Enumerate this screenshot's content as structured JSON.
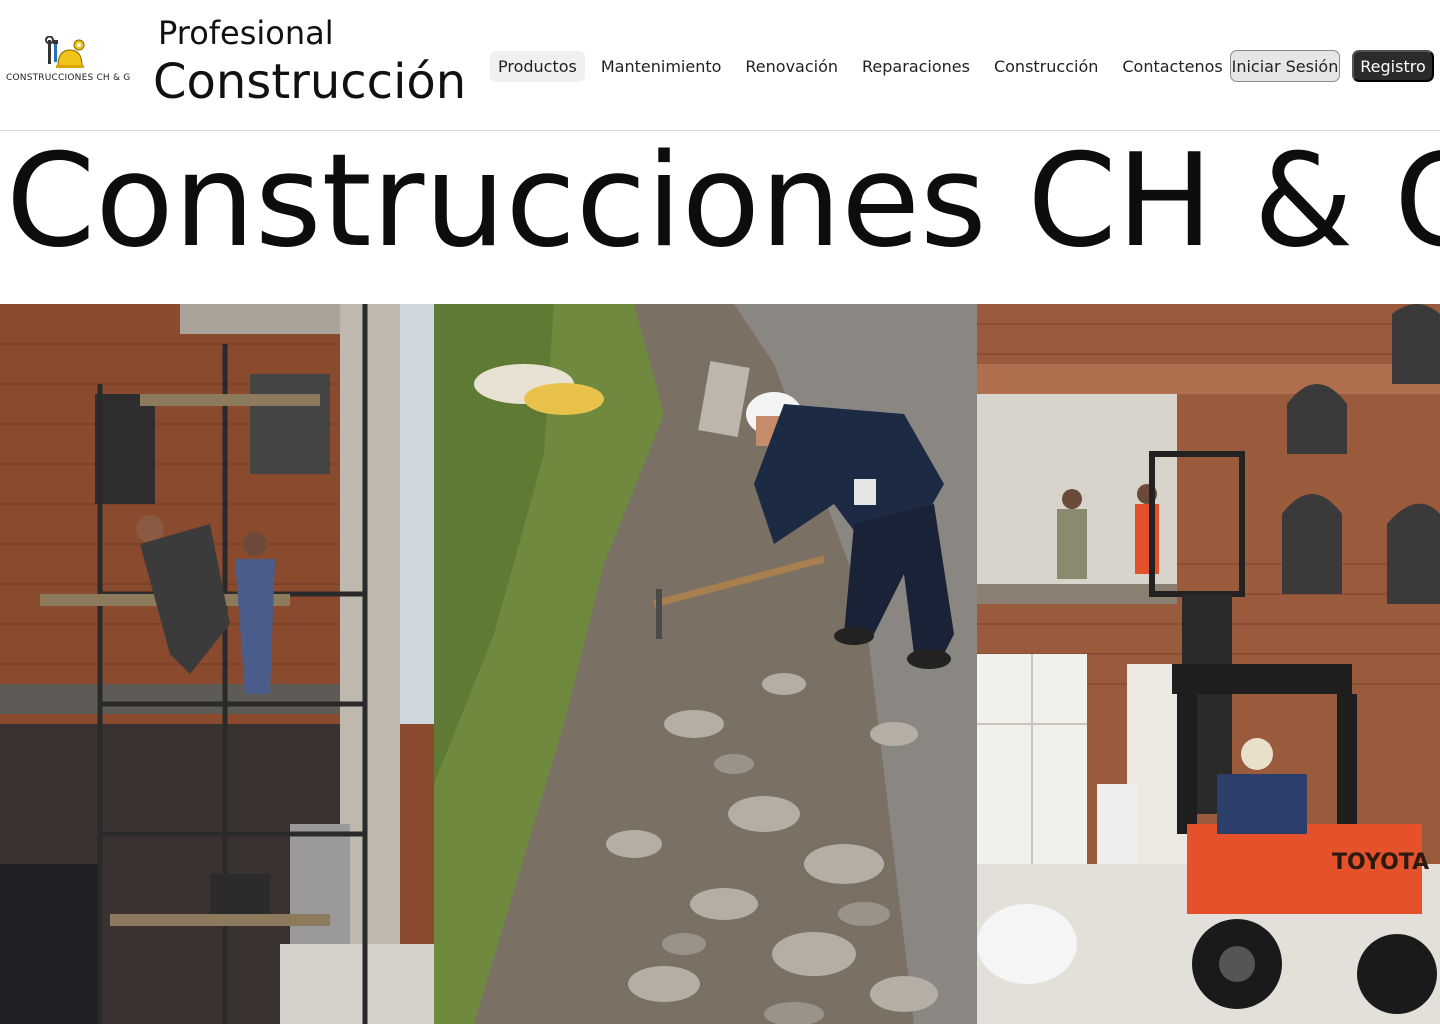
{
  "header": {
    "logo_text": "CONSTRUCCIONES CH & G",
    "brand_top": "Profesional",
    "brand_main": "Construcción",
    "nav": [
      {
        "label": "Productos",
        "active": true
      },
      {
        "label": "Mantenimiento",
        "active": false
      },
      {
        "label": "Renovación",
        "active": false
      },
      {
        "label": "Reparaciones",
        "active": false
      },
      {
        "label": "Construcción",
        "active": false
      },
      {
        "label": "Contactenos",
        "active": false
      }
    ],
    "login_label": "Iniciar Sesión",
    "register_label": "Registro"
  },
  "hero": {
    "title": "Construcciones CH & G"
  },
  "gallery": {
    "photos": [
      {
        "subject": "worker-on-scaffolding-brick-facade"
      },
      {
        "subject": "worker-with-pickaxe-rubble"
      },
      {
        "subject": "forklift-at-brick-building"
      }
    ]
  },
  "colors": {
    "accent_dark": "#2b2b2b",
    "login_bg": "#e6e6e6",
    "active_nav_bg": "#f0f0f0",
    "brick": "#8a4a2e",
    "forklift": "#e5512a"
  }
}
